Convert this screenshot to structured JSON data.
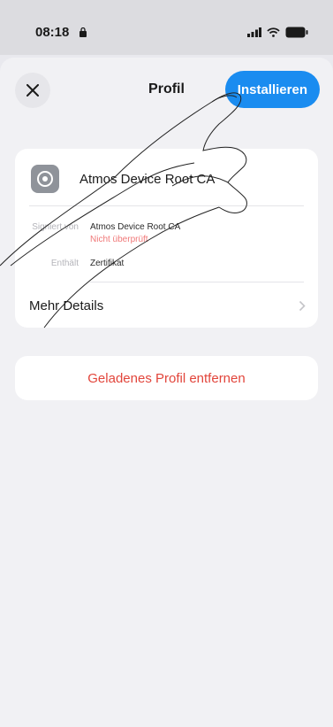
{
  "status_bar": {
    "time": "08:18"
  },
  "nav": {
    "title": "Profil",
    "install_label": "Installieren"
  },
  "profile": {
    "name": "Atmos Device Root CA",
    "signed_by_label": "Signiert von",
    "signed_by_value": "Atmos Device Root CA",
    "verification_status": "Nicht überprüft",
    "contains_label": "Enthält",
    "contains_value": "Zertifikat",
    "more_details_label": "Mehr Details"
  },
  "actions": {
    "remove_label": "Geladenes Profil entfernen"
  },
  "colors": {
    "accent": "#1a8cf0",
    "destructive": "#e2453b",
    "warning": "#f07878"
  }
}
